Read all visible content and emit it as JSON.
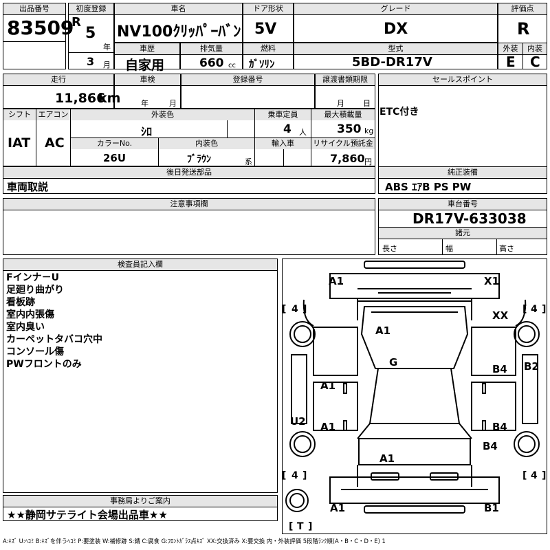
{
  "header": {
    "lot_label": "出品番号",
    "lot_value": "83509",
    "first_reg_label": "初度登録",
    "era": "R",
    "year_value": "5",
    "year_unit": "年",
    "month_value": "3",
    "month_unit": "月",
    "car_name_label": "車名",
    "car_name_value": "NV100ｸﾘｯﾊﾟｰﾊﾞﾝ",
    "history_label": "車歴",
    "history_value": "自家用",
    "displacement_label": "排気量",
    "displacement_value": "660",
    "displacement_unit": "cc",
    "door_label": "ドア形状",
    "door_value": "5V",
    "fuel_label": "燃料",
    "fuel_value": "ｶﾞｿﾘﾝ",
    "grade_label": "グレード",
    "grade_value": "DX",
    "model_label": "型式",
    "model_value": "5BD-DR17V",
    "score_label": "評価点",
    "score_value": "R",
    "ext_label": "外装",
    "ext_value": "E",
    "int_label": "内装",
    "int_value": "C"
  },
  "row2": {
    "mileage_label": "走行",
    "mileage_value": "11,866",
    "mileage_unit": "km",
    "inspection_label": "車検",
    "insp_year_unit": "年",
    "insp_month_unit": "月",
    "regno_label": "登録番号",
    "transfer_label": "譲渡書類期限",
    "transfer_month_unit": "月",
    "transfer_day_unit": "日",
    "sales_label": "セールスポイント",
    "sales_value": "ETC付き"
  },
  "row3": {
    "shift_label": "シフト",
    "shift_value": "IAT",
    "ac_label": "エアコン",
    "ac_value": "AC",
    "ext_color_label": "外装色",
    "ext_color_value": "ｼﾛ",
    "capacity_label": "乗車定員",
    "capacity_value": "4",
    "capacity_unit": "人",
    "load_label": "最大積載量",
    "load_value": "350",
    "load_unit": "kg",
    "color_no_label": "カラーNo.",
    "color_no_value": "26U",
    "int_color_label": "内装色",
    "int_color_value": "ﾌﾞﾗｳﾝ",
    "int_color_suffix": "系",
    "import_label": "輸入車",
    "recycle_label": "リサイクル預託金",
    "recycle_value": "7,860",
    "recycle_unit": "円"
  },
  "row4": {
    "later_label": "後日発送部品",
    "later_value": "車両取説",
    "equip_label": "純正装備",
    "equip_value": "ABS ｴｱB PS PW"
  },
  "row5": {
    "notes_label": "注意事項欄",
    "chassis_label": "車台番号",
    "chassis_value": "DR17V-633038",
    "dims_label": "諸元",
    "length_label": "長さ",
    "width_label": "幅",
    "height_label": "高さ"
  },
  "inspector": {
    "label": "検査員記入欄",
    "lines": [
      "Fインナ－U",
      "足廻り曲がり",
      "看板跡",
      "室内内張傷",
      "室内臭い",
      "カーペットタバコ穴中",
      "コンソール傷",
      "PWフロントのみ"
    ]
  },
  "office": {
    "label": "事務局よりご案内",
    "value": "★★静岡サテライト会場出品車★★"
  },
  "diagram": {
    "marks": {
      "fl": "A1",
      "fr": "X1",
      "xx": "XX",
      "hood": "A1",
      "roof": "G",
      "ldf": "A1",
      "ldr": "A1",
      "rdf": "B4",
      "rdr": "B4",
      "rb": "B2",
      "lu": "U2",
      "rq": "B4",
      "tail": "A1",
      "bl": "A1",
      "br": "B1"
    },
    "tire_tl": "4",
    "tire_tr": "4",
    "tire_bl": "4",
    "tire_br": "4",
    "spare": "T"
  },
  "legend": "A:ｷｽﾞ U:ﾍｺﾐ B:ｷｽﾞを伴うﾍｺﾐ P:要塗装 W:補修跡 S:錆 C:腐食 G:ﾌﾛﾝﾄｶﾞﾗｽ点ｷｽﾞ XX:交換済み X:要交換 内・外装評価 5段階ﾗﾝｸ順(A・B・C・D・E) 1"
}
